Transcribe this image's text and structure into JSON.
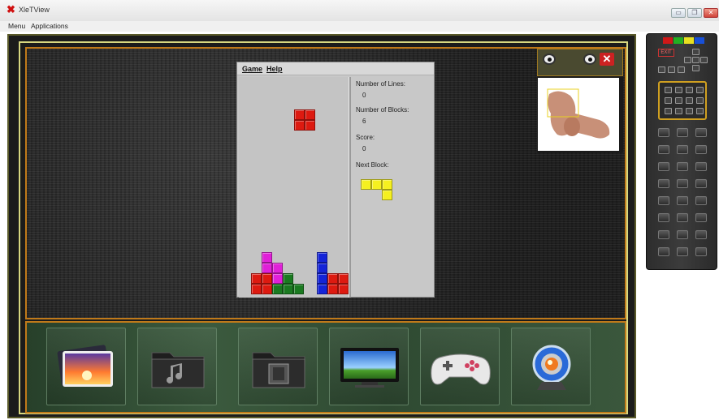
{
  "window": {
    "title": "XleTView",
    "controls": [
      "▭",
      "❐",
      "✕"
    ]
  },
  "menubar": {
    "items": [
      "Menu",
      "Applications"
    ]
  },
  "tetris": {
    "menu": [
      "Game",
      "Help"
    ],
    "stats": [
      {
        "label": "Number of Lines:",
        "value": "0"
      },
      {
        "label": "Number of Blocks:",
        "value": "6"
      },
      {
        "label": "Score:",
        "value": "0"
      },
      {
        "label": "Next Block:",
        "value": ""
      }
    ],
    "block_colors": {
      "red": "#dd1a10",
      "magenta": "#e020d8",
      "green": "#1a7a20",
      "blue": "#1424d8",
      "yellow": "#f5f020"
    }
  },
  "dock": {
    "items": [
      {
        "name": "photos",
        "icon": "photos-icon"
      },
      {
        "name": "music",
        "icon": "music-folder-icon"
      },
      {
        "name": "video",
        "icon": "video-folder-icon"
      },
      {
        "name": "tv",
        "icon": "tv-icon"
      },
      {
        "name": "games",
        "icon": "gamepad-icon"
      },
      {
        "name": "webcam",
        "icon": "webcam-icon"
      }
    ]
  },
  "camera_panel": {
    "close": "✕"
  },
  "remote": {
    "color_keys": [
      "#d01818",
      "#22b022",
      "#e8e020",
      "#1850d8"
    ],
    "exit_label": "EXIT"
  },
  "colors": {
    "frame_orange": "#c07a1a",
    "frame_yellow": "#d8d880",
    "dock_green": "#3b5a3e"
  }
}
